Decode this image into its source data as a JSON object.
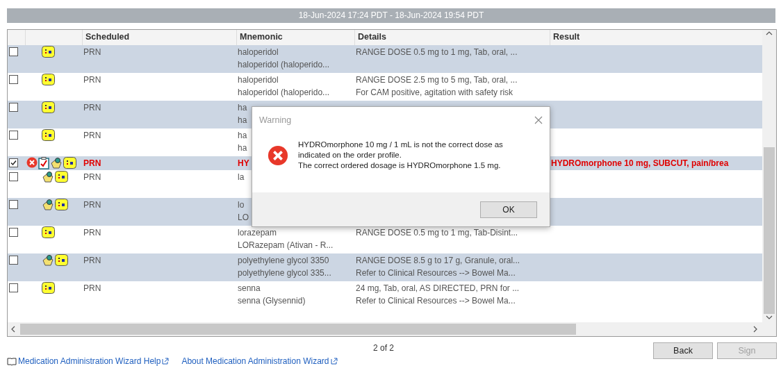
{
  "date_range": "18-Jun-2024 17:24 PDT - 18-Jun-2024 19:54 PDT",
  "table": {
    "columns": [
      "Scheduled",
      "Mnemonic",
      "Details",
      "Result"
    ],
    "rows": [
      {
        "checked": false,
        "alert": false,
        "icons": [
          {
            "kind": "med"
          }
        ],
        "scheduled": "PRN",
        "mnemonic": [
          "haloperidol",
          "haloperidol (haloperido..."
        ],
        "details": [
          "RANGE DOSE 0.5 mg to 1 mg, Tab, oral, ..."
        ]
      },
      {
        "checked": false,
        "alert": false,
        "icons": [
          {
            "kind": "med"
          }
        ],
        "scheduled": "PRN",
        "mnemonic": [
          "haloperidol",
          "haloperidol (haloperido..."
        ],
        "details": [
          "RANGE DOSE 2.5 mg to 5 mg, Tab, oral, ...",
          "For CAM positive, agitation with safety risk"
        ]
      },
      {
        "checked": false,
        "alert": false,
        "icons": [
          {
            "kind": "med"
          }
        ],
        "scheduled": "PRN",
        "mnemonic": [
          "ha",
          "ha"
        ],
        "details": []
      },
      {
        "checked": false,
        "alert": false,
        "icons": [
          {
            "kind": "med"
          }
        ],
        "scheduled": "PRN",
        "mnemonic": [
          "ha",
          "ha"
        ],
        "details": []
      },
      {
        "checked": true,
        "alert": true,
        "icons": [
          {
            "kind": "error"
          },
          {
            "kind": "task"
          },
          {
            "kind": "hand"
          },
          {
            "kind": "med"
          }
        ],
        "scheduled": "PRN",
        "mnemonic": [
          "HY"
        ],
        "details": [],
        "result": "HYDROmorphone 10 mg, SUBCUT, pain/brea"
      },
      {
        "checked": false,
        "alert": false,
        "icons": [
          {
            "kind": "hand"
          },
          {
            "kind": "med"
          }
        ],
        "scheduled": "PRN",
        "mnemonic": [
          "la"
        ],
        "details": []
      },
      {
        "checked": false,
        "alert": false,
        "icons": [
          {
            "kind": "hand"
          },
          {
            "kind": "med"
          }
        ],
        "scheduled": "PRN",
        "mnemonic": [
          "lo",
          "LO"
        ],
        "details": []
      },
      {
        "checked": false,
        "alert": false,
        "icons": [
          {
            "kind": "med"
          }
        ],
        "scheduled": "PRN",
        "mnemonic": [
          "lorazepam",
          "LORazepam (Ativan - R..."
        ],
        "details": [
          "RANGE DOSE 0.5 mg to 1 mg, Tab-Disint..."
        ]
      },
      {
        "checked": false,
        "alert": false,
        "icons": [
          {
            "kind": "hand"
          },
          {
            "kind": "med"
          }
        ],
        "scheduled": "PRN",
        "mnemonic": [
          "polyethylene glycol 3350",
          "polyethylene glycol 335..."
        ],
        "details": [
          "RANGE DOSE 8.5 g to 17 g, Granule, oral...",
          "Refer to Clinical Resources --> Bowel Ma..."
        ]
      },
      {
        "checked": false,
        "alert": false,
        "icons": [
          {
            "kind": "med"
          }
        ],
        "scheduled": "PRN",
        "mnemonic": [
          "senna",
          "senna (Glysennid)"
        ],
        "details": [
          "24 mg, Tab, oral, AS DIRECTED, PRN for ...",
          "Refer to Clinical Resources --> Bowel Ma..."
        ]
      }
    ]
  },
  "dialog": {
    "title": "Warning",
    "message": [
      "HYDROmorphone 10 mg / 1 mL is not the correct dose as",
      "indicated on the order profile.",
      "The correct ordered dosage is HYDROmorphone 1.5 mg."
    ],
    "button": "OK"
  },
  "pager": "2 of 2",
  "buttons": [
    {
      "label": "Back",
      "disabled": false
    },
    {
      "label": "Sign",
      "disabled": true
    }
  ],
  "links": [
    "Medication Administration Wizard Help",
    "About Medication Administration Wizard"
  ]
}
